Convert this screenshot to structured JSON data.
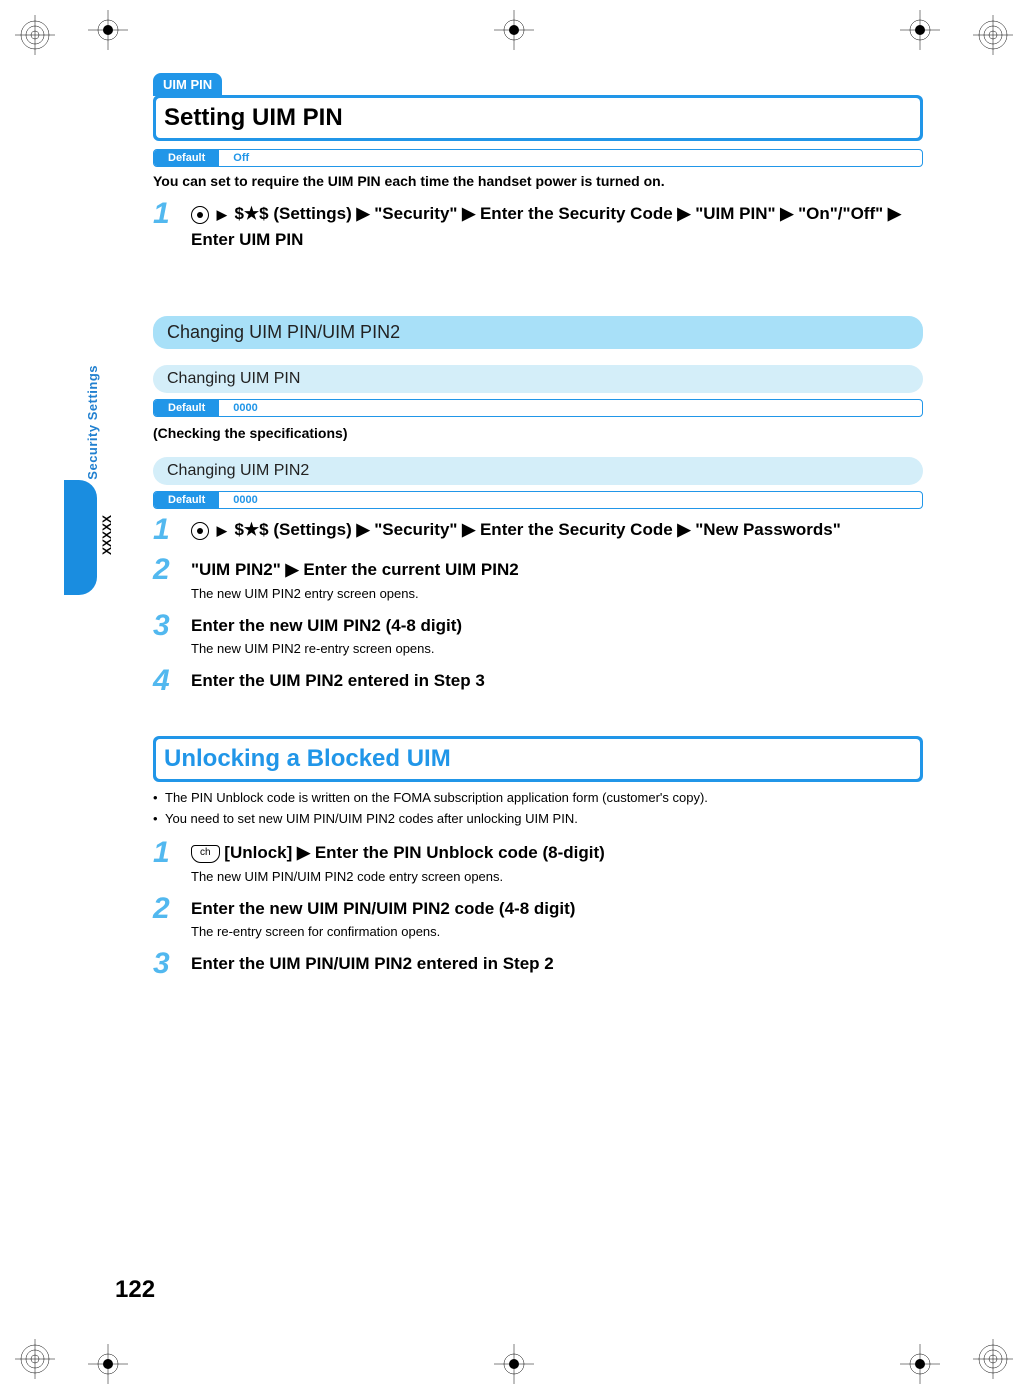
{
  "side": {
    "tab_label": "Security Settings",
    "chapter": "XXXXX"
  },
  "section1": {
    "category": "UIM PIN",
    "title": "Setting UIM PIN",
    "default_label": "Default",
    "default_value": "Off",
    "intro": "You can set to require the UIM PIN each time the handset power is turned on.",
    "step1": "$★$ (Settings) ▶ \"Security\" ▶ Enter the Security Code ▶ \"UIM PIN\" ▶ \"On\"/\"Off\" ▶ Enter UIM PIN"
  },
  "subsection1": {
    "title": "Changing UIM PIN/UIM PIN2"
  },
  "subsub1": {
    "title": "Changing UIM PIN",
    "default_label": "Default",
    "default_value": "0000",
    "checking": "(Checking the specifications)"
  },
  "subsub2": {
    "title": "Changing UIM PIN2",
    "default_label": "Default",
    "default_value": "0000",
    "steps": [
      {
        "num": "1",
        "text_a": "$★$ (Settings) ▶ \"Security\" ▶ Enter the Security Code ▶ \"New Passwords\""
      },
      {
        "num": "2",
        "text": "\"UIM PIN2\" ▶ Enter the current UIM PIN2",
        "note": "The new UIM PIN2 entry screen opens."
      },
      {
        "num": "3",
        "text": "Enter the new UIM PIN2 (4-8 digit)",
        "note": "The new UIM PIN2 re-entry screen opens."
      },
      {
        "num": "4",
        "text": "Enter the UIM PIN2 entered in Step 3"
      }
    ]
  },
  "section2": {
    "title": "Unlocking a Blocked UIM",
    "bullets": [
      "The PIN Unblock code is written on the FOMA subscription application form (customer's copy).",
      "You need to set new UIM PIN/UIM PIN2 codes after unlocking UIM PIN."
    ],
    "key_label": "ch",
    "steps": [
      {
        "num": "1",
        "text": "[Unlock] ▶ Enter the PIN Unblock code (8-digit)",
        "note": "The new UIM PIN/UIM PIN2 code entry screen opens."
      },
      {
        "num": "2",
        "text": "Enter the new UIM PIN/UIM PIN2 code (4-8 digit)",
        "note": "The re-entry screen for confirmation opens."
      },
      {
        "num": "3",
        "text": "Enter the UIM PIN/UIM PIN2 entered in Step 2"
      }
    ]
  },
  "page_number": "122"
}
